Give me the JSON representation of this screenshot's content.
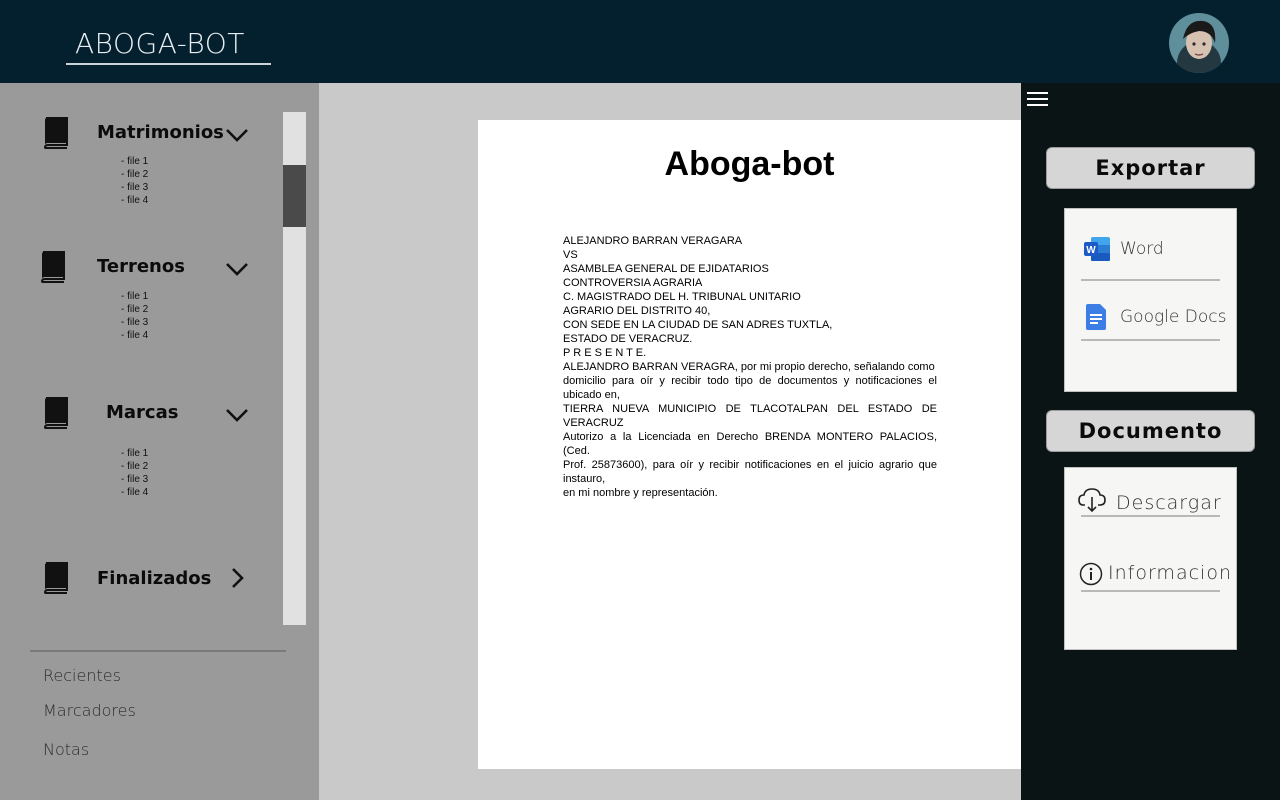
{
  "header": {
    "app_title": "ABOGA-BOT"
  },
  "sidebar": {
    "categories": [
      {
        "title": "Matrimonios",
        "files": [
          "- file 1",
          "- file 2",
          "- file 3",
          "- file 4"
        ],
        "expanded": true
      },
      {
        "title": "Terrenos",
        "files": [
          "- file 1",
          "- file 2",
          "- file 3",
          "- file 4"
        ],
        "expanded": true
      },
      {
        "title": "Marcas",
        "files": [
          "- file 1",
          "- file 2",
          "- file 3",
          "- file 4"
        ],
        "expanded": true
      },
      {
        "title": "Finalizados",
        "files": [],
        "expanded": false
      }
    ],
    "links": [
      "Recientes",
      "Marcadores",
      "Notas"
    ]
  },
  "document": {
    "title": "Aboga-bot",
    "lines": [
      "ALEJANDRO BARRAN VERAGARA",
      "VS",
      "ASAMBLEA GENERAL DE EJIDATARIOS",
      "CONTROVERSIA AGRARIA",
      "C. MAGISTRADO DEL H. TRIBUNAL UNITARIO",
      "AGRARIO DEL DISTRITO 40,",
      "CON SEDE EN LA CIUDAD DE SAN ADRES TUXTLA,",
      "ESTADO DE VERACRUZ.",
      "P R E S E N T E.",
      "ALEJANDRO BARRAN VERAGRA, por mi propio derecho, señalando como",
      "domicilio para oír y recibir todo tipo de documentos y notificaciones el ubicado en,",
      "TIERRA NUEVA MUNICIPIO DE TLACOTALPAN DEL ESTADO DE VERACRUZ",
      "Autorizo a la Licenciada en Derecho BRENDA MONTERO PALACIOS, (Ced.",
      "Prof. 25873600), para oír y recibir notificaciones en el juicio agrario que instauro,",
      "en mi nombre y representación."
    ]
  },
  "rpanel": {
    "export_label": "Exportar",
    "export_options": [
      "Word",
      "Google Docs"
    ],
    "document_label": "Documento",
    "document_options": [
      "Descargar",
      "Informacion"
    ]
  },
  "colors": {
    "header_bg": "#04202e",
    "sidebar_bg": "#9a9a9a",
    "rpanel_bg": "#0b1414",
    "word_blue": "#1e5bc6",
    "gdocs_blue": "#3c7de6"
  }
}
